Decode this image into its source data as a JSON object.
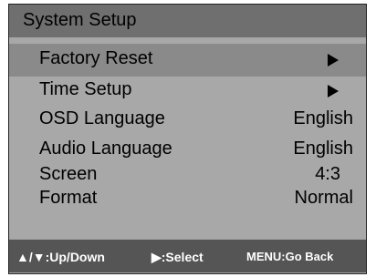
{
  "title": "System Setup",
  "menu": [
    {
      "label": "Factory Reset",
      "value": "",
      "icon": "play-arrow-icon"
    },
    {
      "label": "Time Setup",
      "value": "",
      "icon": "play-arrow-icon"
    },
    {
      "label": "OSD Language",
      "value": "English"
    },
    {
      "label": "Audio Language",
      "value": "English"
    },
    {
      "label": "Screen",
      "value": "4:3"
    },
    {
      "label": "Format",
      "value": "Normal"
    }
  ],
  "footer": {
    "updown": "▲/▼:Up/Down",
    "select": "▶:Select",
    "menu": "MENU:Go Back"
  },
  "colors": {
    "title_bar": "#6f6f6f",
    "panel": "#a8a8a8",
    "selected_row": "#8a8a8a",
    "footer_bar": "#555555"
  }
}
